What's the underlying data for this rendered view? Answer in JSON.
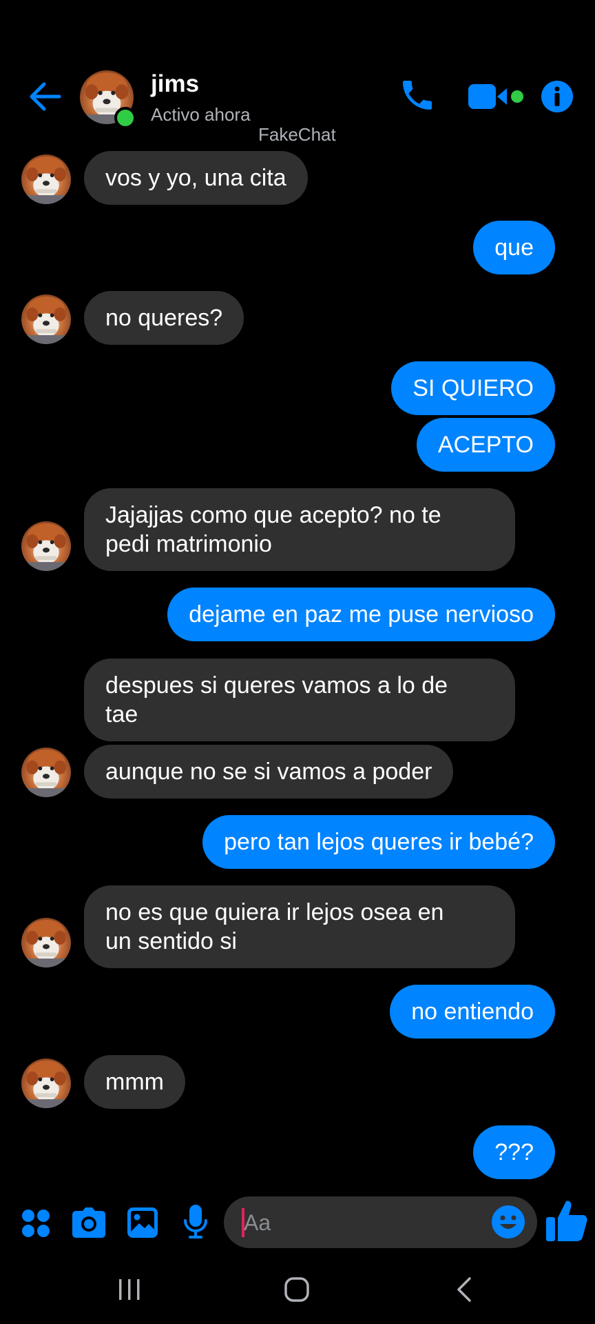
{
  "header": {
    "contact_name": "jims",
    "status": "Activo ahora",
    "watermark": "FakeChat"
  },
  "colors": {
    "accent": "#0084ff",
    "received_bubble": "#303030",
    "online": "#31cc46",
    "background": "#000000"
  },
  "messages": [
    {
      "from": "them",
      "text": "vos y yo, una cita",
      "avatar": true
    },
    {
      "from": "me",
      "text": "que"
    },
    {
      "from": "them",
      "text": "no queres?",
      "avatar": true
    },
    {
      "from": "me",
      "text": "SI QUIERO"
    },
    {
      "from": "me",
      "text": "ACEPTO"
    },
    {
      "from": "them",
      "text": "Jajajjas como que acepto? no te\npedi matrimonio",
      "avatar": true
    },
    {
      "from": "me",
      "text": "dejame en paz me puse nervioso"
    },
    {
      "from": "them",
      "text": "despues si queres vamos a lo de\ntae",
      "avatar": false
    },
    {
      "from": "them",
      "text": "aunque no se si vamos a poder",
      "avatar": true
    },
    {
      "from": "me",
      "text": "pero tan lejos queres ir bebé?"
    },
    {
      "from": "them",
      "text": "no es que quiera ir lejos osea en\nun sentido si",
      "avatar": true
    },
    {
      "from": "me",
      "text": "no entiendo"
    },
    {
      "from": "them",
      "text": "mmm",
      "avatar": true
    },
    {
      "from": "me",
      "text": "???"
    }
  ],
  "composer": {
    "placeholder": "Aa"
  },
  "icons": {
    "back": "arrow-left-icon",
    "call": "phone-icon",
    "video": "video-camera-icon",
    "info": "info-icon",
    "menu": "four-dots-icon",
    "camera": "camera-icon",
    "gallery": "image-icon",
    "mic": "microphone-icon",
    "emoji": "smiley-icon",
    "like": "thumbs-up-icon",
    "nav_recents": "recents-icon",
    "nav_home": "home-icon",
    "nav_back": "chevron-back-icon"
  }
}
